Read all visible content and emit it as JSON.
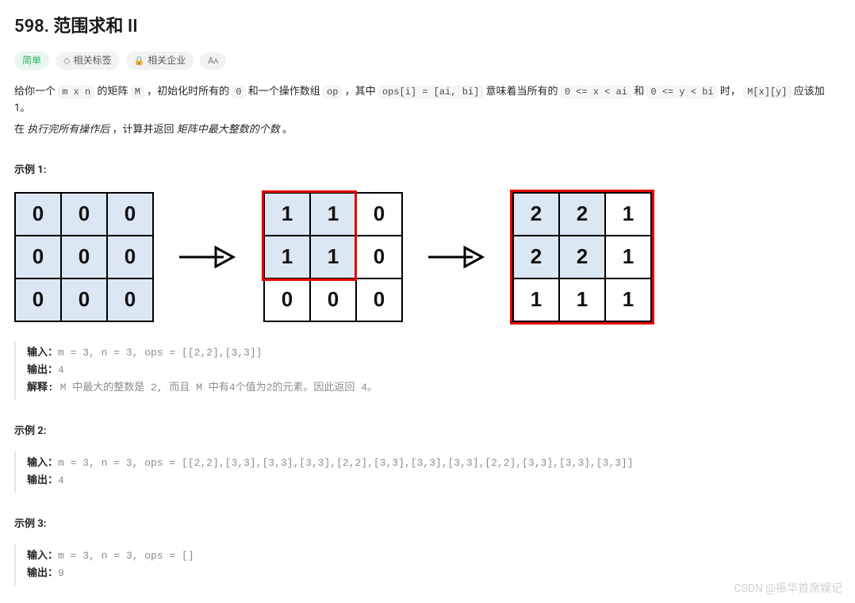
{
  "title": "598. 范围求和 II",
  "tags": {
    "difficulty": "简单",
    "related_tags": "相关标签",
    "related_companies": "相关企业"
  },
  "desc": {
    "p1a": "给你一个 ",
    "c1": "m x n",
    "p1b": " 的矩阵 ",
    "c2": "M",
    "p1c": " ，初始化时所有的 ",
    "c3": "0",
    "p1d": " 和一个操作数组 ",
    "c4": "op",
    "p1e": " ，其中 ",
    "c5": "ops[i] = [ai, bi]",
    "p1f": " 意味着当所有的 ",
    "c6": "0 <= x < ai",
    "p1g": " 和 ",
    "c7": "0 <= y < bi",
    "p1h": " 时， ",
    "c8": "M[x][y]",
    "p1i": " 应该加 1。",
    "p2a": "在 ",
    "p2em": "执行完所有操作后",
    "p2b": " ，计算并返回 ",
    "p2em2": "矩阵中最大整数的个数",
    "p2c": " 。"
  },
  "example_labels": {
    "e1": "示例 1:",
    "e2": "示例 2:",
    "e3": "示例 3:"
  },
  "grids": {
    "g1": [
      [
        "0",
        "0",
        "0"
      ],
      [
        "0",
        "0",
        "0"
      ],
      [
        "0",
        "0",
        "0"
      ]
    ],
    "g2": [
      [
        "1",
        "1",
        "0"
      ],
      [
        "1",
        "1",
        "0"
      ],
      [
        "0",
        "0",
        "0"
      ]
    ],
    "g3": [
      [
        "2",
        "2",
        "1"
      ],
      [
        "2",
        "2",
        "1"
      ],
      [
        "1",
        "1",
        "1"
      ]
    ]
  },
  "ex1": {
    "l1b": "输入：",
    "l1": "m = 3, n = 3, ops = [[2,2],[3,3]]",
    "l2b": "输出：",
    "l2": "4",
    "l3b": "解释: ",
    "l3": "M 中最大的整数是 2, 而且 M 中有4个值为2的元素。因此返回 4。"
  },
  "ex2": {
    "l1b": "输入：",
    "l1": "m = 3, n = 3, ops = [[2,2],[3,3],[3,3],[3,3],[2,2],[3,3],[3,3],[3,3],[2,2],[3,3],[3,3],[3,3]]",
    "l2b": "输出：",
    "l2": "4"
  },
  "ex3": {
    "l1b": "输入：",
    "l1": "m = 3, n = 3, ops = []",
    "l2b": "输出：",
    "l2": "9"
  },
  "watermark": "CSDN @振华首席娱记"
}
